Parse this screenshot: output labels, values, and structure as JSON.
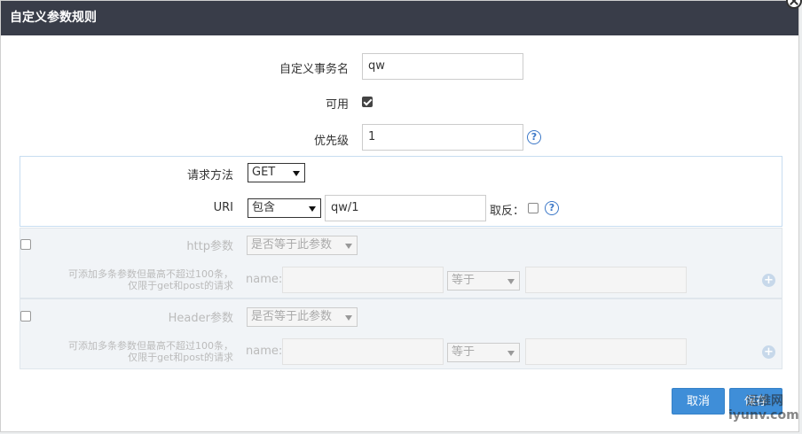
{
  "dialog": {
    "title": "自定义参数规则"
  },
  "form": {
    "name_label": "自定义事务名",
    "name_value": "qw",
    "enabled_label": "可用",
    "enabled_checked": true,
    "priority_label": "优先级",
    "priority_value": "1",
    "help_symbol": "?"
  },
  "request": {
    "method_label": "请求方法",
    "method_value": "GET",
    "uri_label": "URI",
    "uri_match_value": "包含",
    "uri_value": "qw/1",
    "invert_label": "取反：",
    "invert_checked": false
  },
  "http_params": {
    "label": "http参数",
    "mode_value": "是否等于此参数",
    "hint_line1": "可添加多条参数但最高不超过100条，",
    "hint_line2": "仅限于get和post的请求",
    "name_label": "name:",
    "operator_value": "等于",
    "add_symbol": "+"
  },
  "header_params": {
    "label": "Header参数",
    "mode_value": "是否等于此参数",
    "hint_line1": "可添加多条参数但最高不超过100条，",
    "hint_line2": "仅限于get和post的请求",
    "name_label": "name:",
    "operator_value": "等于",
    "add_symbol": "+"
  },
  "footer": {
    "cancel_label": "取消",
    "save_label": "保存"
  },
  "watermark": {
    "line1": "运维网",
    "line2": "iyunv.com"
  },
  "colors": {
    "title_bar": "#393d49",
    "primary_button": "#3f8ed8",
    "help_icon": "#3c78c8",
    "request_panel_border": "#c7ddf1",
    "param_panel_bg": "#f1f4f7"
  }
}
